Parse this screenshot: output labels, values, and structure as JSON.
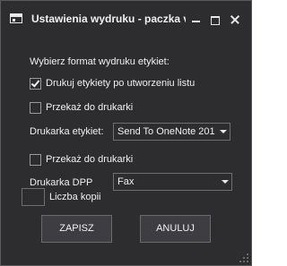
{
  "window": {
    "title": "Ustawienia wydruku - paczka v"
  },
  "form": {
    "heading": "Wybierz format wydruku etykiet:",
    "print_after_create": {
      "label": "Drukuj etykiety po utworzeniu listu",
      "checked": true
    },
    "pass_to_printer_1": {
      "label": "Przekaż do drukarki",
      "checked": false
    },
    "label_printer": {
      "label": "Drukarka etykiet:",
      "value": "Send To OneNote 201"
    },
    "pass_to_printer_2": {
      "label": "Przekaż do drukarki",
      "checked": false
    },
    "dpp_printer": {
      "label": "Drukarka DPP",
      "value": "Fax"
    },
    "copies": {
      "label": "Liczba kopii",
      "value": ""
    }
  },
  "buttons": {
    "save": "ZAPISZ",
    "cancel": "ANULUJ"
  },
  "icons": {
    "app": "window-icon",
    "minimize": "minimize-icon",
    "maximize": "maximize-icon",
    "close": "close-icon",
    "dropdown": "chevron-down-icon",
    "check": "check-icon"
  },
  "colors": {
    "background": "#2d2d30",
    "text": "#f1f1f1",
    "border": "#6f6f6f"
  }
}
